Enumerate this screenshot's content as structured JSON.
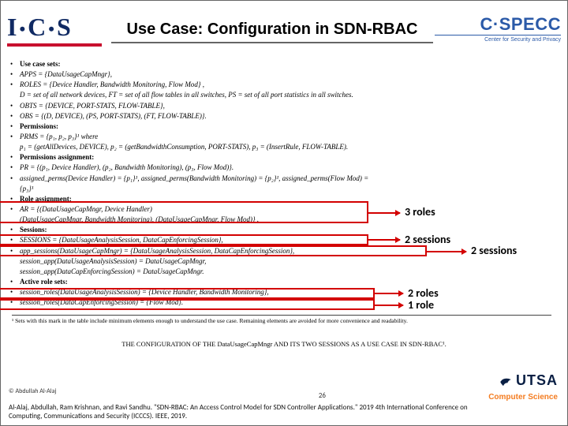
{
  "header": {
    "left_logo_text": "I·C·S",
    "title": "Use Case: Configuration in SDN-RBAC",
    "right_logo_main": "C·SPECC",
    "right_logo_sub": "Center for Security and Privacy"
  },
  "sections": {
    "use_case_sets": "Use case sets:",
    "l1": "APPS = {DataUsageCapMngr},",
    "l2": "ROLES = {Device Handler, Bandwidth Monitoring, Flow Mod} ,",
    "l3": "D = set of all network devices, FT = set of all flow tables in all switches, PS = set of all port statistics in all switches.",
    "l4": "OBTS = {DEVICE, PORT-STATS, FLOW-TABLE},",
    "l5": "OBS = {(D, DEVICE), (PS, PORT-STATS), (FT, FLOW-TABLE)}.",
    "permissions": "Permissions:",
    "l6": "PRMS = {p₁, p₂, p₃}¹ where",
    "l7": "p₁ = (getAllDevices, DEVICE), p₂ = (getBandwidthConsumption, PORT-STATS), p₃ = (InsertRule, FLOW-TABLE).",
    "perm_assign": "Permissions assignment:",
    "l8": "PR = {(p₁, Device Handler), (p₂, Bandwidth Monitoring), (p₃, Flow Mod)}.",
    "l9": "assigned_perms(Device Handler) = {p₁}¹, assigned_perms(Bandwidth Monitoring) = {p₂}¹, assigned_perms(Flow Mod) =",
    "l9b": "{p₃}¹",
    "role_assign": "Role assignment:",
    "l10": "AR = {(DataUsageCapMngr, Device Handler)",
    "l11": "(DataUsageCapMngr, Bandwidth Monitoring), (DataUsageCapMngr, Flow Mod)} .",
    "sessions": "Sessions:",
    "l12": "SESSIONS = {DataUsageAnalysisSession, DataCapEnforcingSession},",
    "l13": "app_sessions(DataUsageCapMngr) = {DataUsageAnalysisSession, DataCapEnforcingSession},",
    "l14": "session_app(DataUsageAnalysisSession) = DataUsageCapMngr,",
    "l15": "session_app(DataCapEnforcingSession) = DataUsageCapMngr.",
    "active_role": "Active role sets:",
    "l16": "session_roles(DataUsageAnalysisSession) = {Device Handler, Bandwidth Monitoring},",
    "l17": "session_roles(DataCapEnforcingSession) = {Flow Mod}."
  },
  "annotations": {
    "ann1": "3 roles",
    "ann2": "2 sessions",
    "ann3": "2 sessions",
    "ann4": "2 roles",
    "ann5": "1 role"
  },
  "footnote": "¹ Sets with this mark in the table include minimum elements enough to understand the use case. Remaining elements are avoided for more convenience and readability.",
  "caption": "THE CONFIGURATION OF THE DataUsageCapMngr AND ITS TWO SESSIONS AS A USE CASE IN SDN-RBAC¹.",
  "footer": {
    "copyright": "© Abdullah Al-Alaj",
    "citation": "Al-Alaj, Abdullah, Ram Krishnan, and Ravi Sandhu. \"SDN-RBAC: An Access Control Model for SDN Controller Applications.\" 2019 4th International Conference on Computing, Communications and Security (ICCCS). IEEE, 2019.",
    "page": "26",
    "utsa_main": "UTSA",
    "utsa_sub": "Computer Science"
  }
}
